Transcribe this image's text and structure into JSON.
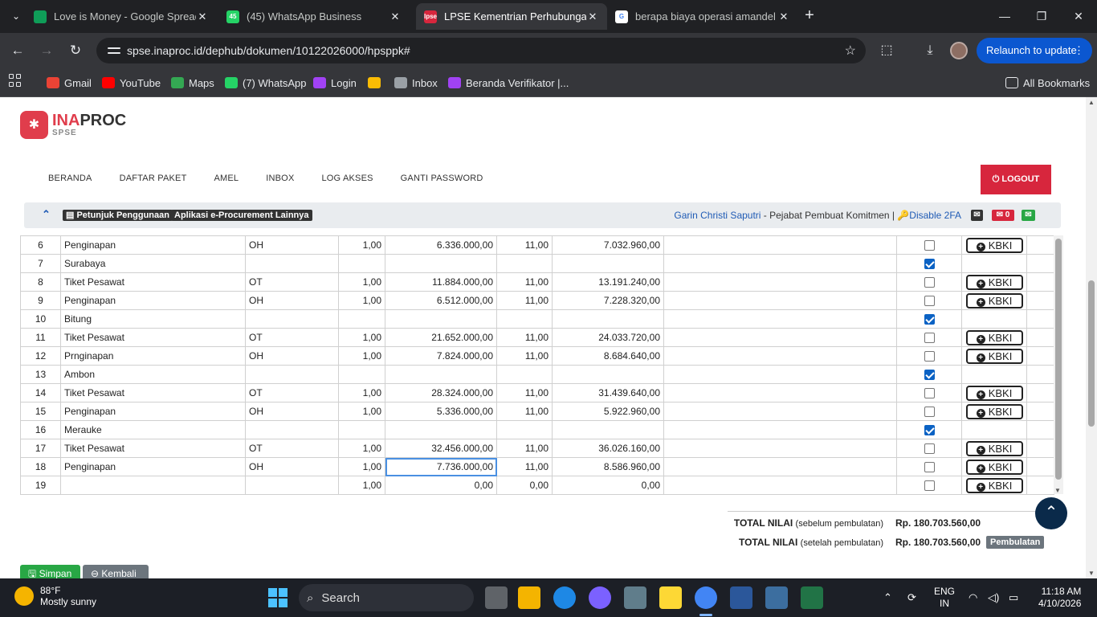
{
  "browser": {
    "tabs": [
      {
        "title": "Love is Money - Google Spread",
        "fav_color": "#0f9d58",
        "fav_text": ""
      },
      {
        "title": "(45) WhatsApp Business",
        "fav_color": "#25d366",
        "fav_text": "45"
      },
      {
        "title": "LPSE Kementrian Perhubungan",
        "fav_color": "#d7263d",
        "fav_text": "lpse"
      },
      {
        "title": "berapa biaya operasi amandel -",
        "fav_color": "#ffffff",
        "fav_text": "G"
      }
    ],
    "url": "spse.inaproc.id/dephub/dokumen/10122026000/hpsppk#",
    "relaunch_label": "Relaunch to update",
    "bookmarks": [
      {
        "label": "Gmail",
        "color": "#ea4335"
      },
      {
        "label": "YouTube",
        "color": "#ff0000"
      },
      {
        "label": "Maps",
        "color": "#34a853"
      },
      {
        "label": "(7) WhatsApp",
        "color": "#25d366"
      },
      {
        "label": "Login",
        "color": "#a142f4"
      },
      {
        "label": "",
        "color": "#fbbc04"
      },
      {
        "label": "Inbox",
        "color": "#9aa0a6"
      },
      {
        "label": "Beranda Verifikator |...",
        "color": "#a142f4"
      }
    ],
    "all_bookmarks_label": "All Bookmarks"
  },
  "site": {
    "logo_ina": "INA",
    "logo_proc": "PROC",
    "logo_sub": "SPSE",
    "nav": [
      "BERANDA",
      "DAFTAR PAKET",
      "AMEL",
      "INBOX",
      "LOG AKSES",
      "GANTI PASSWORD"
    ],
    "logout_label": "LOGOUT",
    "petunjuk_label": "Petunjuk Penggunaan",
    "aplikasi_label": "Aplikasi e-Procurement Lainnya",
    "user_name": "Garin Christi Saputri",
    "user_role": " - Pejabat Pembuat Komitmen | ",
    "disable_2fa": "Disable 2FA",
    "mail_badge_count": "0"
  },
  "table": {
    "kbki_label": "KBKI",
    "rows": [
      {
        "no": "6",
        "name": "Penginapan",
        "unit": "OH",
        "vol": "1,00",
        "price": "6.336.000,00",
        "ppn": "11,00",
        "total": "7.032.960,00",
        "checked": false,
        "kbki": true
      },
      {
        "no": "7",
        "name": "Surabaya",
        "unit": "",
        "vol": "",
        "price": "",
        "ppn": "",
        "total": "",
        "checked": true,
        "kbki": false
      },
      {
        "no": "8",
        "name": "Tiket Pesawat",
        "unit": "OT",
        "vol": "1,00",
        "price": "11.884.000,00",
        "ppn": "11,00",
        "total": "13.191.240,00",
        "checked": false,
        "kbki": true
      },
      {
        "no": "9",
        "name": "Penginapan",
        "unit": "OH",
        "vol": "1,00",
        "price": "6.512.000,00",
        "ppn": "11,00",
        "total": "7.228.320,00",
        "checked": false,
        "kbki": true
      },
      {
        "no": "10",
        "name": "Bitung",
        "unit": "",
        "vol": "",
        "price": "",
        "ppn": "",
        "total": "",
        "checked": true,
        "kbki": false
      },
      {
        "no": "11",
        "name": "Tiket Pesawat",
        "unit": "OT",
        "vol": "1,00",
        "price": "21.652.000,00",
        "ppn": "11,00",
        "total": "24.033.720,00",
        "checked": false,
        "kbki": true
      },
      {
        "no": "12",
        "name": "Prnginapan",
        "unit": "OH",
        "vol": "1,00",
        "price": "7.824.000,00",
        "ppn": "11,00",
        "total": "8.684.640,00",
        "checked": false,
        "kbki": true
      },
      {
        "no": "13",
        "name": "Ambon",
        "unit": "",
        "vol": "",
        "price": "",
        "ppn": "",
        "total": "",
        "checked": true,
        "kbki": false
      },
      {
        "no": "14",
        "name": "Tiket Pesawat",
        "unit": "OT",
        "vol": "1,00",
        "price": "28.324.000,00",
        "ppn": "11,00",
        "total": "31.439.640,00",
        "checked": false,
        "kbki": true
      },
      {
        "no": "15",
        "name": "Penginapan",
        "unit": "OH",
        "vol": "1,00",
        "price": "5.336.000,00",
        "ppn": "11,00",
        "total": "5.922.960,00",
        "checked": false,
        "kbki": true
      },
      {
        "no": "16",
        "name": "Merauke",
        "unit": "",
        "vol": "",
        "price": "",
        "ppn": "",
        "total": "",
        "checked": true,
        "kbki": false
      },
      {
        "no": "17",
        "name": "Tiket Pesawat",
        "unit": "OT",
        "vol": "1,00",
        "price": "32.456.000,00",
        "ppn": "11,00",
        "total": "36.026.160,00",
        "checked": false,
        "kbki": true
      },
      {
        "no": "18",
        "name": "Penginapan",
        "unit": "OH",
        "vol": "1,00",
        "price": "7.736.000,00",
        "ppn": "11,00",
        "total": "8.586.960,00",
        "checked": false,
        "kbki": true,
        "focused": true
      },
      {
        "no": "19",
        "name": "",
        "unit": "",
        "vol": "1,00",
        "price": "0,00",
        "ppn": "0,00",
        "total": "0,00",
        "checked": false,
        "kbki": true
      }
    ]
  },
  "totals": {
    "before_label": "TOTAL NILAI",
    "before_note": "(sebelum pembulatan)",
    "before_value": "Rp. 180.703.560,00",
    "after_label": "TOTAL NILAI",
    "after_note": "(setelah pembulatan)",
    "after_value": "Rp. 180.703.560,00",
    "pembulatan_label": "Pembulatan"
  },
  "actions": {
    "simpan_label": "Simpan",
    "kembali_label": "Kembali"
  },
  "taskbar": {
    "temp": "88°F",
    "weather": "Mostly sunny",
    "search_placeholder": "Search",
    "lang_line1": "ENG",
    "lang_line2": "IN",
    "time": "11:18 AM",
    "date": "4/10/2026"
  }
}
